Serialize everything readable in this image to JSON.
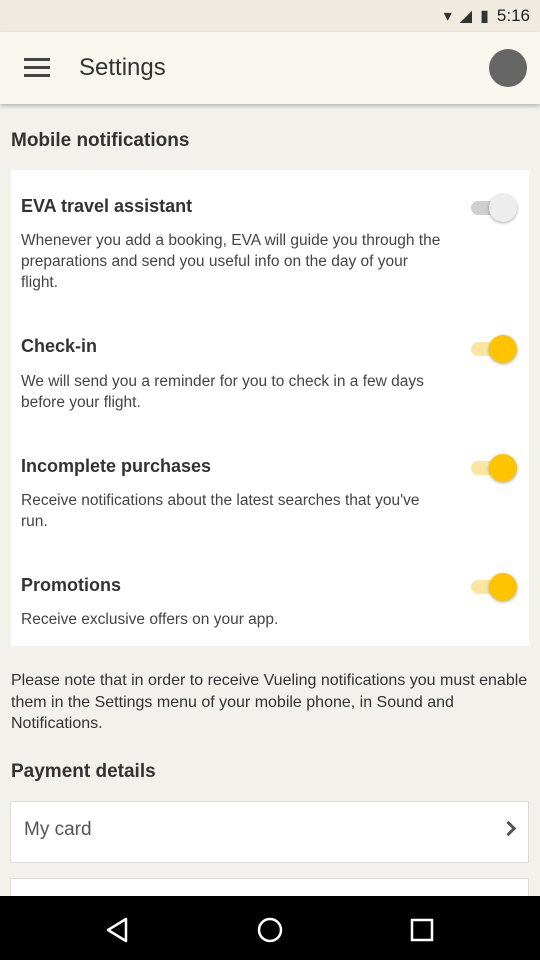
{
  "status_bar": {
    "time": "5:16"
  },
  "app_bar": {
    "title": "Settings"
  },
  "mobile_notifications": {
    "title": "Mobile notifications",
    "items": [
      {
        "title": "EVA travel assistant",
        "description": "Whenever you add a booking, EVA will guide you through the preparations and send you useful info on the day of your flight.",
        "enabled": false
      },
      {
        "title": "Check-in",
        "description": "We will send you a reminder for you to check in a few days before your flight.",
        "enabled": true
      },
      {
        "title": "Incomplete purchases",
        "description": "Receive notifications about the latest searches that you've run.",
        "enabled": true
      },
      {
        "title": "Promotions",
        "description": "Receive exclusive offers on your app.",
        "enabled": true
      }
    ]
  },
  "note": "Please note that in order to receive Vueling notifications you must enable them in the Settings menu of your mobile phone, in Sound and Notifications.",
  "payment": {
    "title": "Payment details",
    "my_card_label": "My card"
  },
  "icons": {
    "menu": "hamburger-menu-icon",
    "avatar": "profile-avatar",
    "chevron": "chevron-right-icon",
    "nav_back": "back-triangle-icon",
    "nav_home": "home-circle-icon",
    "nav_recent": "recent-square-icon"
  },
  "colors": {
    "accent": "#FFC400",
    "app_bar": "#F8F6EF",
    "background": "#F3F1EC"
  }
}
